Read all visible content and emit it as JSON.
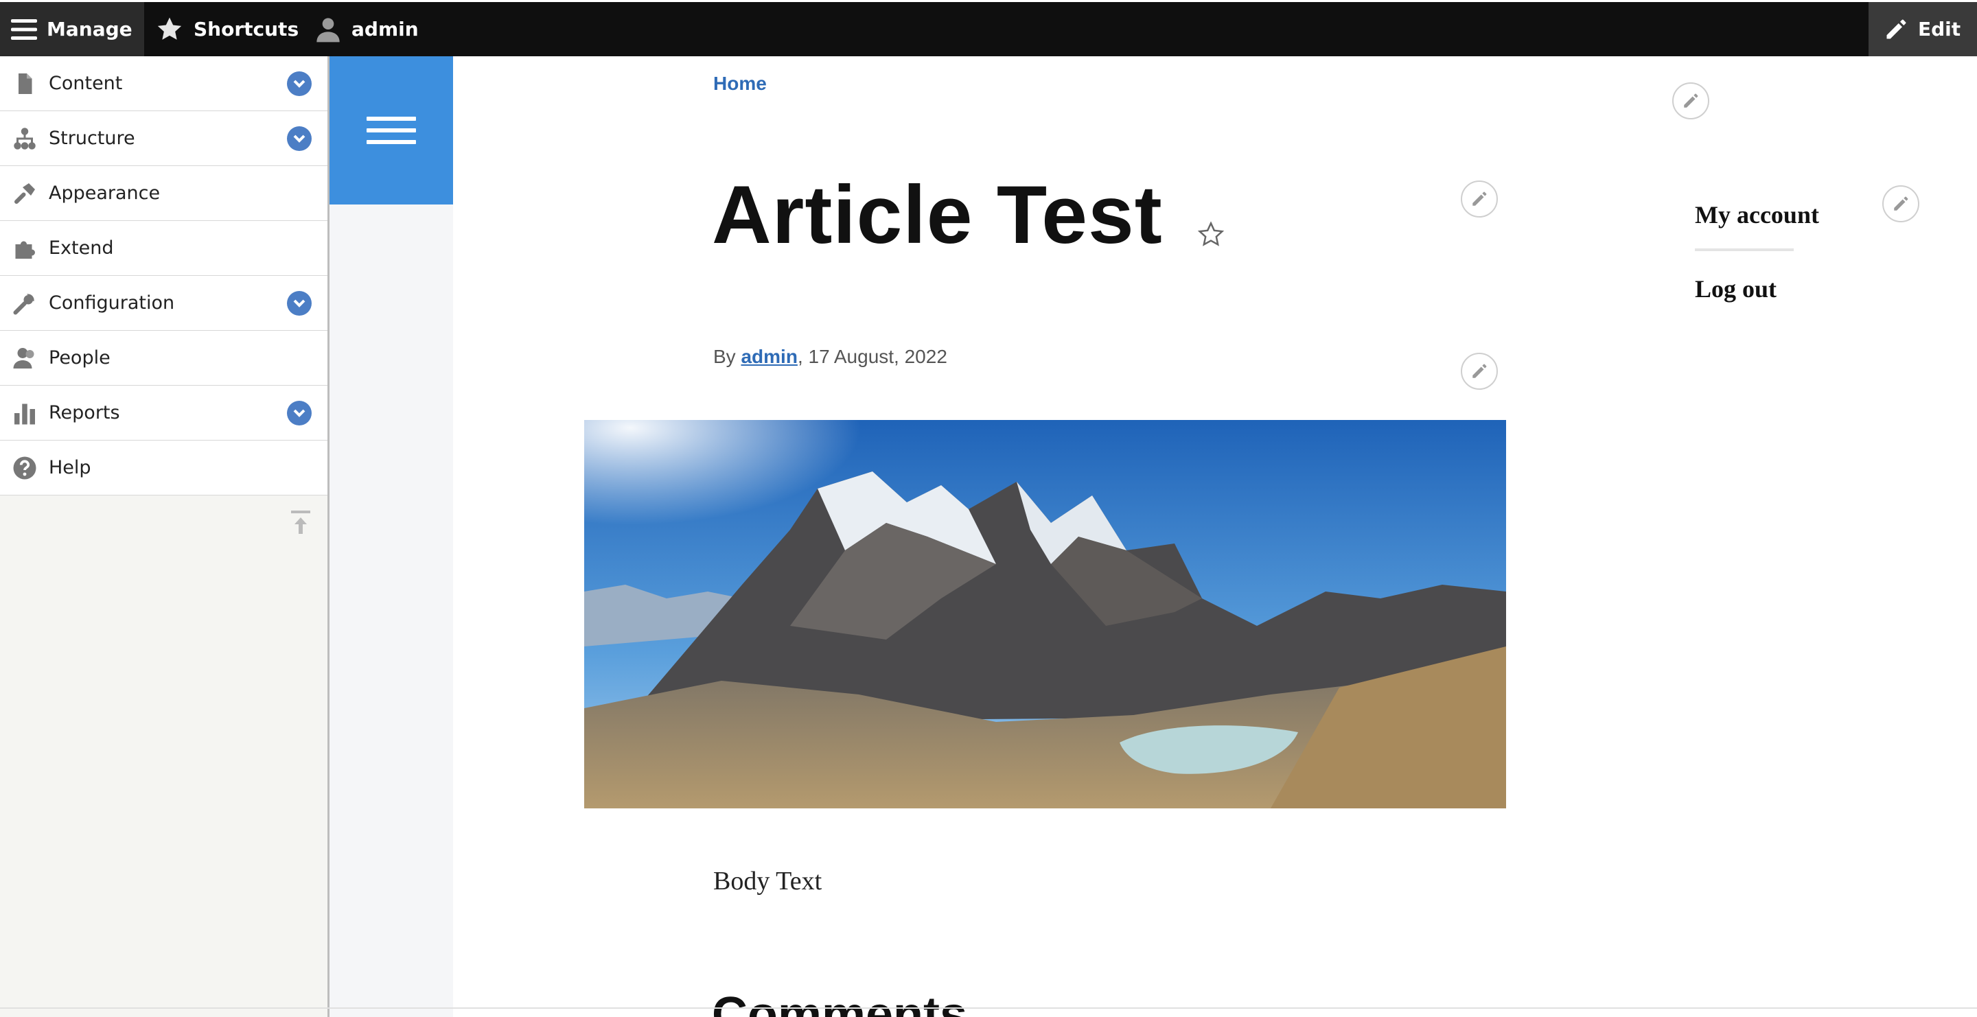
{
  "toolbar": {
    "manage_label": "Manage",
    "shortcuts_label": "Shortcuts",
    "user_label": "admin",
    "edit_label": "Edit",
    "background": "#0f0f0f"
  },
  "admin_menu": {
    "items": [
      {
        "label": "Content",
        "icon": "file-icon",
        "expandable": true
      },
      {
        "label": "Structure",
        "icon": "sitemap-icon",
        "expandable": true
      },
      {
        "label": "Appearance",
        "icon": "paintbrush-icon",
        "expandable": false
      },
      {
        "label": "Extend",
        "icon": "puzzle-icon",
        "expandable": false
      },
      {
        "label": "Configuration",
        "icon": "wrench-icon",
        "expandable": true
      },
      {
        "label": "People",
        "icon": "people-icon",
        "expandable": false
      },
      {
        "label": "Reports",
        "icon": "bar-chart-icon",
        "expandable": true
      },
      {
        "label": "Help",
        "icon": "help-icon",
        "expandable": false
      }
    ],
    "toggle_color": "#4c7ec5"
  },
  "theme": {
    "accent": "#3d8fde",
    "link": "#2e6bb6"
  },
  "breadcrumb": {
    "home_label": "Home"
  },
  "article": {
    "title": "Article Test",
    "byline_prefix": "By",
    "author": "admin",
    "date": ", 17 August, 2022",
    "image_alt": "mountain-landscape",
    "body": "Body Text",
    "comments_heading": "Comments"
  },
  "account_menu": {
    "my_account": "My account",
    "log_out": "Log out"
  }
}
